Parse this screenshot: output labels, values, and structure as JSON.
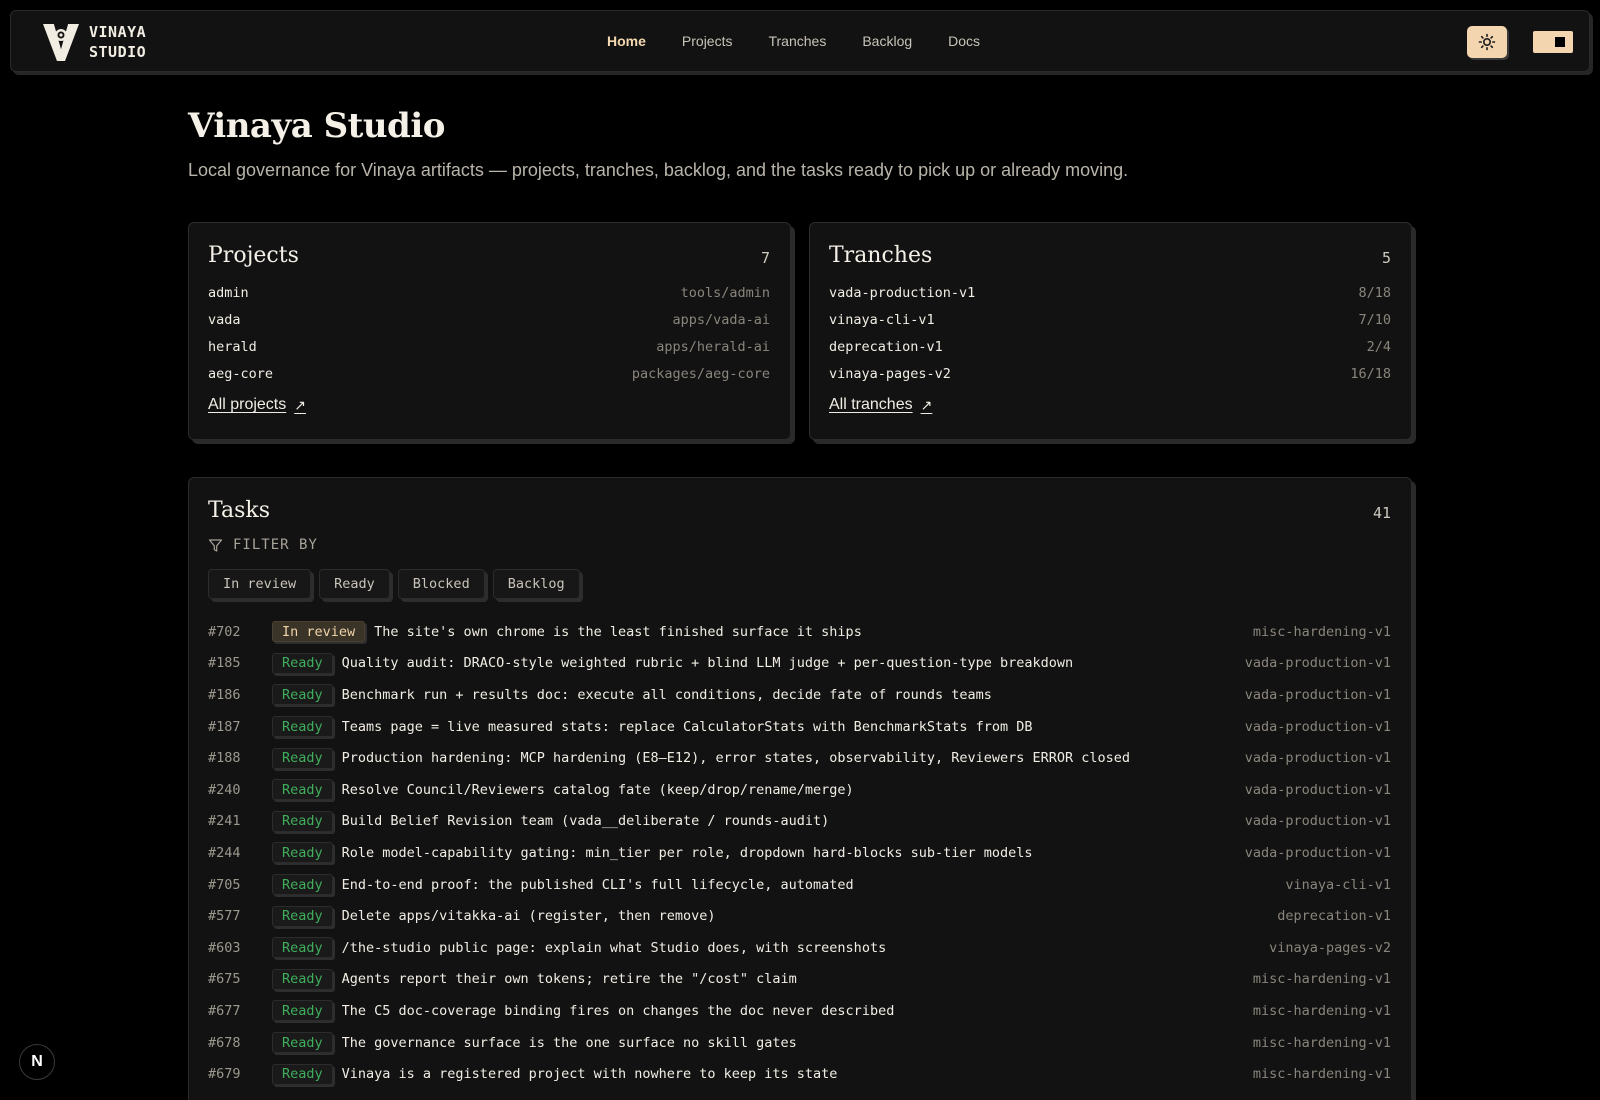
{
  "header": {
    "brand_line1": "VINAYA",
    "brand_line2": "STUDIO",
    "nav": [
      "Home",
      "Projects",
      "Tranches",
      "Backlog",
      "Docs"
    ],
    "active_nav": "Home",
    "theme_icon": "sun-icon",
    "accent": "#f3d6b0"
  },
  "hero": {
    "title": "Vinaya Studio",
    "subtitle": "Local governance for Vinaya artifacts — projects, tranches, backlog, and the tasks ready to pick up or already moving."
  },
  "projects": {
    "title": "Projects",
    "count": "7",
    "items": [
      {
        "name": "admin",
        "path": "tools/admin"
      },
      {
        "name": "vada",
        "path": "apps/vada-ai"
      },
      {
        "name": "herald",
        "path": "apps/herald-ai"
      },
      {
        "name": "aeg-core",
        "path": "packages/aeg-core"
      }
    ],
    "link": "All projects",
    "link_arrow": "↗"
  },
  "tranches": {
    "title": "Tranches",
    "count": "5",
    "items": [
      {
        "name": "vada-production-v1",
        "progress": "8/18"
      },
      {
        "name": "vinaya-cli-v1",
        "progress": "7/10"
      },
      {
        "name": "deprecation-v1",
        "progress": "2/4"
      },
      {
        "name": "vinaya-pages-v2",
        "progress": "16/18"
      }
    ],
    "link": "All tranches",
    "link_arrow": "↗"
  },
  "tasks": {
    "title": "Tasks",
    "count": "41",
    "filter_label": "FILTER BY",
    "filters": [
      "In review",
      "Ready",
      "Blocked",
      "Backlog"
    ],
    "rows": [
      {
        "id": "#702",
        "status": "In review",
        "title": "The site's own chrome is the least finished surface it ships",
        "tranche": "misc-hardening-v1"
      },
      {
        "id": "#185",
        "status": "Ready",
        "title": "Quality audit: DRACO-style weighted rubric + blind LLM judge + per-question-type breakdown",
        "tranche": "vada-production-v1"
      },
      {
        "id": "#186",
        "status": "Ready",
        "title": "Benchmark run + results doc: execute all conditions, decide fate of rounds teams",
        "tranche": "vada-production-v1"
      },
      {
        "id": "#187",
        "status": "Ready",
        "title": "Teams page = live measured stats: replace CalculatorStats with BenchmarkStats from DB",
        "tranche": "vada-production-v1"
      },
      {
        "id": "#188",
        "status": "Ready",
        "title": "Production hardening: MCP hardening (E8–E12), error states, observability, Reviewers ERROR closed",
        "tranche": "vada-production-v1"
      },
      {
        "id": "#240",
        "status": "Ready",
        "title": "Resolve Council/Reviewers catalog fate (keep/drop/rename/merge)",
        "tranche": "vada-production-v1"
      },
      {
        "id": "#241",
        "status": "Ready",
        "title": "Build Belief Revision team (vada__deliberate / rounds-audit)",
        "tranche": "vada-production-v1"
      },
      {
        "id": "#244",
        "status": "Ready",
        "title": "Role model-capability gating: min_tier per role, dropdown hard-blocks sub-tier models",
        "tranche": "vada-production-v1"
      },
      {
        "id": "#705",
        "status": "Ready",
        "title": "End-to-end proof: the published CLI's full lifecycle, automated",
        "tranche": "vinaya-cli-v1"
      },
      {
        "id": "#577",
        "status": "Ready",
        "title": "Delete apps/vitakka-ai (register, then remove)",
        "tranche": "deprecation-v1"
      },
      {
        "id": "#603",
        "status": "Ready",
        "title": "/the-studio public page: explain what Studio does, with screenshots",
        "tranche": "vinaya-pages-v2"
      },
      {
        "id": "#675",
        "status": "Ready",
        "title": "Agents report their own tokens; retire the \"/cost\" claim",
        "tranche": "misc-hardening-v1"
      },
      {
        "id": "#677",
        "status": "Ready",
        "title": "The C5 doc-coverage binding fires on changes the doc never described",
        "tranche": "misc-hardening-v1"
      },
      {
        "id": "#678",
        "status": "Ready",
        "title": "The governance surface is the one surface no skill gates",
        "tranche": "misc-hardening-v1"
      },
      {
        "id": "#679",
        "status": "Ready",
        "title": "Vinaya is a registered project with nowhere to keep its state",
        "tranche": "misc-hardening-v1"
      }
    ]
  },
  "corner_badge": "N"
}
